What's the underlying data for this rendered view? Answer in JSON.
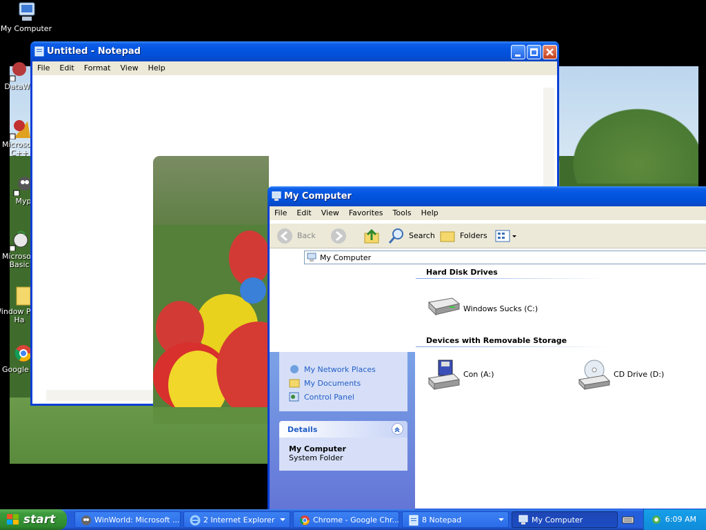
{
  "desktop": {
    "icons": [
      {
        "label": "My Computer"
      },
      {
        "label": "DataWa"
      },
      {
        "label": "Microsoft C++"
      },
      {
        "label": "Myp"
      },
      {
        "label": "Microsoft Basic"
      },
      {
        "label": "Window Plus! Ha"
      },
      {
        "label": "Google C"
      }
    ]
  },
  "notepad": {
    "title": "Untitled - Notepad",
    "menu": [
      "File",
      "Edit",
      "Format",
      "View",
      "Help"
    ]
  },
  "explorer": {
    "title": "My Computer",
    "menu": [
      "File",
      "Edit",
      "View",
      "Favorites",
      "Tools",
      "Help"
    ],
    "toolbar": {
      "back": "Back",
      "search": "Search",
      "folders": "Folders"
    },
    "address": "My Computer",
    "sections": [
      {
        "heading": "Hard Disk Drives"
      },
      {
        "heading": "Devices with Removable Storage"
      }
    ],
    "drives": {
      "c": "Windows Sucks (C:)",
      "a": "Con (A:)",
      "d": "CD Drive (D:)"
    },
    "other_places": [
      "My Network Places",
      "My Documents",
      "Control Panel"
    ],
    "details": {
      "heading": "Details",
      "name": "My Computer",
      "type": "System Folder"
    }
  },
  "taskbar": {
    "start": "start",
    "buttons": [
      {
        "label": "WinWorld: Microsoft ..."
      },
      {
        "label": "2 Internet Explorer"
      },
      {
        "label": "Chrome - Google Chr..."
      },
      {
        "label": "8 Notepad"
      },
      {
        "label": "My Computer"
      }
    ],
    "clock": "6:09 AM"
  },
  "colors": {
    "xp_blue": "#0355e0",
    "start_green": "#3c9b3c",
    "link_blue": "#215dc6"
  }
}
